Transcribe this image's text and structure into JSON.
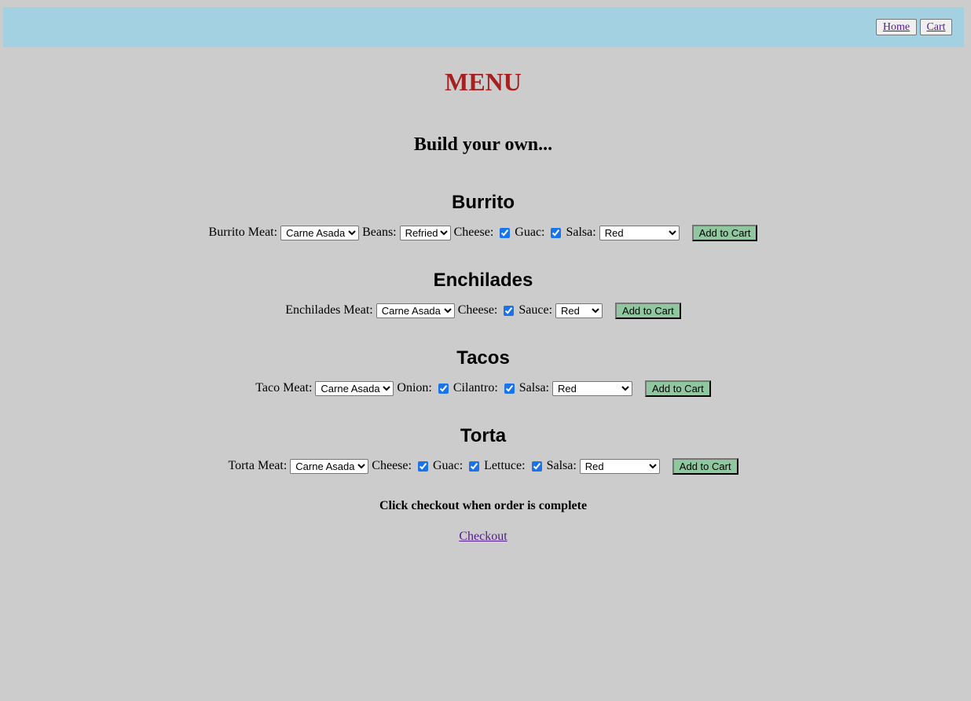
{
  "nav": {
    "home_label": "Home",
    "cart_label": "Cart"
  },
  "page_title": "MENU",
  "subtitle": "Build your own...",
  "sections": {
    "burrito": {
      "title": "Burrito",
      "meat_label": "Burrito Meat:",
      "meat_value": "Carne Asada",
      "beans_label": "Beans:",
      "beans_value": "Refried",
      "cheese_label": "Cheese:",
      "cheese_checked": true,
      "guac_label": "Guac:",
      "guac_checked": true,
      "salsa_label": "Salsa:",
      "salsa_value": "Red",
      "add_label": "Add to Cart"
    },
    "enchilades": {
      "title": "Enchilades",
      "meat_label": "Enchilades Meat:",
      "meat_value": "Carne Asada",
      "cheese_label": "Cheese:",
      "cheese_checked": true,
      "sauce_label": "Sauce:",
      "sauce_value": "Red",
      "add_label": "Add to Cart"
    },
    "tacos": {
      "title": "Tacos",
      "meat_label": "Taco Meat:",
      "meat_value": "Carne Asada",
      "onion_label": "Onion:",
      "onion_checked": true,
      "cilantro_label": "Cilantro:",
      "cilantro_checked": true,
      "salsa_label": "Salsa:",
      "salsa_value": "Red",
      "add_label": "Add to Cart"
    },
    "torta": {
      "title": "Torta",
      "meat_label": "Torta Meat:",
      "meat_value": "Carne Asada",
      "cheese_label": "Cheese:",
      "cheese_checked": true,
      "guac_label": "Guac:",
      "guac_checked": true,
      "lettuce_label": "Lettuce:",
      "lettuce_checked": true,
      "salsa_label": "Salsa:",
      "salsa_value": "Red",
      "add_label": "Add to Cart"
    }
  },
  "footer": {
    "note": "Click checkout when order is complete",
    "checkout_label": "Checkout"
  },
  "colors": {
    "background": "#cccccc",
    "navbar": "#a3d1e2",
    "title": "#a42121",
    "add_button": "#8fc79f",
    "link": "#551a8b"
  }
}
